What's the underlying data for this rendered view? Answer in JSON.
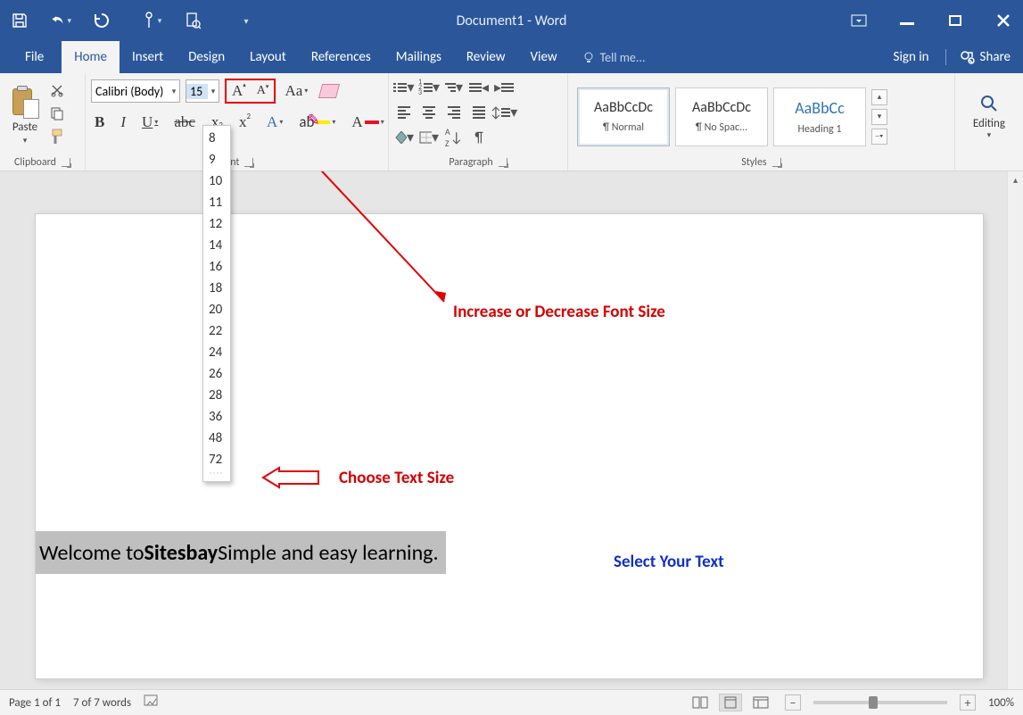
{
  "title": "Document1 - Word",
  "tabs": {
    "file": "File",
    "home": "Home",
    "insert": "Insert",
    "design": "Design",
    "layout": "Layout",
    "references": "References",
    "mailings": "Mailings",
    "review": "Review",
    "view": "View"
  },
  "tell_me": "Tell me...",
  "signin": "Sign in",
  "share": "Share",
  "clipboard": {
    "paste": "Paste",
    "group": "Clipboard"
  },
  "font": {
    "name": "Calibri (Body)",
    "size": "15",
    "group": "Font",
    "sizes": [
      "8",
      "9",
      "10",
      "11",
      "12",
      "14",
      "16",
      "18",
      "20",
      "22",
      "24",
      "26",
      "28",
      "36",
      "48",
      "72"
    ]
  },
  "paragraph": {
    "group": "Paragraph"
  },
  "styles": {
    "group": "Styles",
    "items": [
      {
        "preview": "AaBbCcDc",
        "name": "¶ Normal"
      },
      {
        "preview": "AaBbCcDc",
        "name": "¶ No Spac..."
      },
      {
        "preview": "AaBbCc",
        "name": "Heading 1"
      }
    ]
  },
  "editing": {
    "group": "Editing"
  },
  "annotations": {
    "grow": "Increase or Decrease Font Size",
    "choose": "Choose Text Size",
    "select": "Select Your Text"
  },
  "document": {
    "pre": "Welcome to ",
    "bold": "Sitesbay",
    "post": " Simple and easy learning."
  },
  "status": {
    "page": "Page 1 of 1",
    "words": "7 of 7 words",
    "zoom": "100%"
  }
}
